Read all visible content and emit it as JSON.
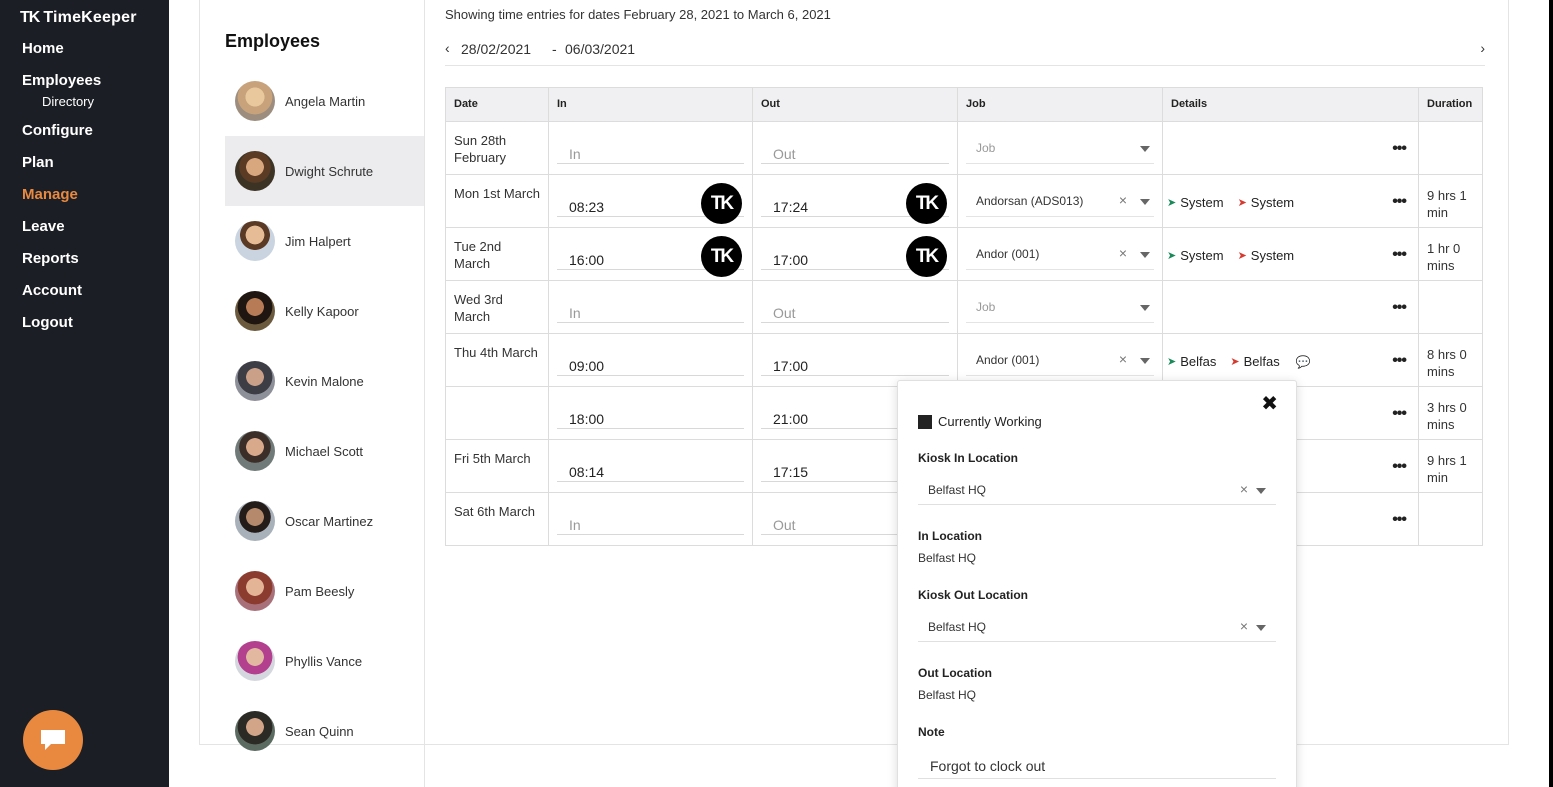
{
  "app": {
    "logo_mark": "TK",
    "logo_text": "TimeKeeper"
  },
  "sidebar": {
    "items": [
      {
        "label": "Home"
      },
      {
        "label": "Employees"
      },
      {
        "label": "Directory"
      },
      {
        "label": "Configure"
      },
      {
        "label": "Plan"
      },
      {
        "label": "Manage"
      },
      {
        "label": "Leave"
      },
      {
        "label": "Reports"
      },
      {
        "label": "Account"
      },
      {
        "label": "Logout"
      }
    ],
    "active_item": "Manage",
    "chat_icon": "chat-icon"
  },
  "employees": {
    "title": "Employees",
    "list": [
      {
        "name": "Angela Martin"
      },
      {
        "name": "Dwight Schrute"
      },
      {
        "name": "Jim Halpert"
      },
      {
        "name": "Kelly Kapoor"
      },
      {
        "name": "Kevin Malone"
      },
      {
        "name": "Michael Scott"
      },
      {
        "name": "Oscar Martinez"
      },
      {
        "name": "Pam Beesly"
      },
      {
        "name": "Phyllis Vance"
      },
      {
        "name": "Sean Quinn"
      }
    ],
    "selected": "Dwight Schrute"
  },
  "range": {
    "caption": "Showing time entries for dates February 28, 2021 to March 6, 2021",
    "start": "28/02/2021",
    "separator": "-",
    "end": "06/03/2021",
    "prev": "‹",
    "next": "›"
  },
  "table": {
    "headers": {
      "date": "Date",
      "in": "In",
      "out": "Out",
      "job": "Job",
      "details": "Details",
      "duration": "Duration"
    },
    "placeholders": {
      "in": "In",
      "out": "Out",
      "job": "Job"
    },
    "badge": "TK",
    "more": "•••",
    "rows": [
      {
        "date": "Sun 28th February",
        "in": "",
        "out": "",
        "job": "",
        "d1": "",
        "d2": "",
        "duration": ""
      },
      {
        "date": "Mon 1st March",
        "in": "08:23",
        "out": "17:24",
        "job": "Andorsan (ADS013)",
        "d1": "System",
        "d2": "System",
        "duration": "9 hrs 1 min"
      },
      {
        "date": "Tue 2nd March",
        "in": "16:00",
        "out": "17:00",
        "job": "Andor (001)",
        "d1": "System",
        "d2": "System",
        "duration": "1 hr 0 mins"
      },
      {
        "date": "Wed 3rd March",
        "in": "",
        "out": "",
        "job": "",
        "d1": "",
        "d2": "",
        "duration": ""
      },
      {
        "date": "Thu 4th March",
        "in": "09:00",
        "out": "17:00",
        "job": "Andor (001)",
        "d1": "Belfas",
        "d2": "Belfas",
        "duration": "8 hrs 0 mins"
      },
      {
        "date": "",
        "in": "18:00",
        "out": "21:00",
        "job": "",
        "d1": "",
        "d2": "",
        "duration": "3 hrs 0 mins"
      },
      {
        "date": "Fri 5th March",
        "in": "08:14",
        "out": "17:15",
        "job": "",
        "d1": "",
        "d2": "",
        "duration": "9 hrs 1 min"
      },
      {
        "date": "Sat 6th March",
        "in": "",
        "out": "",
        "job": "",
        "d1": "",
        "d2": "",
        "duration": ""
      }
    ]
  },
  "popup": {
    "close": "✖",
    "currently_working": "Currently Working",
    "kiosk_in_label": "Kiosk In Location",
    "kiosk_in_value": "Belfast HQ",
    "in_location_label": "In Location",
    "in_location_value": "Belfast HQ",
    "kiosk_out_label": "Kiosk Out Location",
    "kiosk_out_value": "Belfast HQ",
    "out_location_label": "Out Location",
    "out_location_value": "Belfast HQ",
    "note_label": "Note",
    "note_value": "Forgot to clock out"
  },
  "colors": {
    "sidebar_bg": "#1b1e24",
    "accent": "#e8893f",
    "selected_row": "#ececef"
  }
}
